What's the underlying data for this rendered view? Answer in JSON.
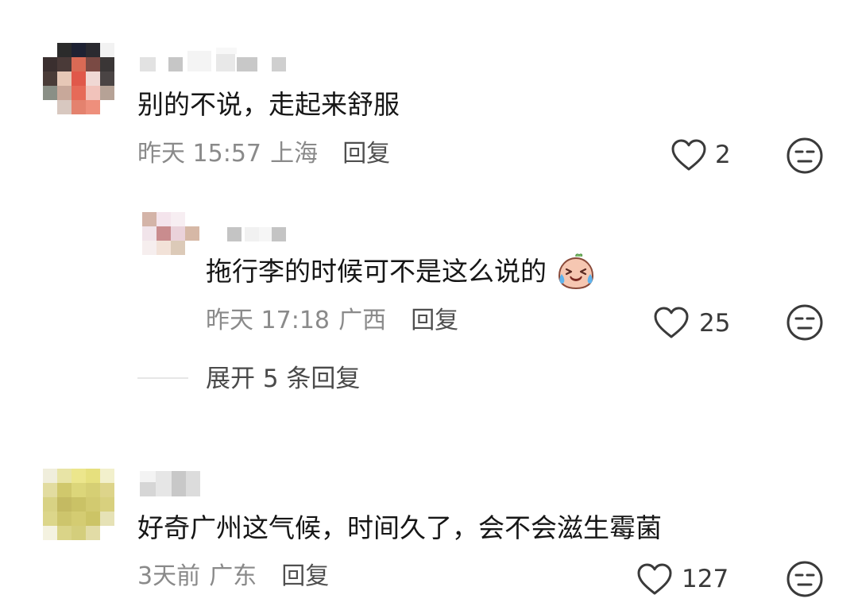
{
  "comments": [
    {
      "text": "别的不说，走起来舒服",
      "time": "昨天 15:57",
      "location": "上海",
      "reply_label": "回复",
      "likes": "2",
      "like_icon": "heart-outline-icon",
      "dislike_icon": "neutral-face-icon"
    },
    {
      "text": "拖行李的时候可不是这么说的",
      "emoji": "crying-face-emoji",
      "time": "昨天 17:18",
      "location": "广西",
      "reply_label": "回复",
      "likes": "25",
      "like_icon": "heart-outline-icon",
      "dislike_icon": "neutral-face-icon"
    },
    {
      "text": "好奇广州这气候，时间久了，会不会滋生霉菌",
      "time": "3天前",
      "location": "广东",
      "reply_label": "回复",
      "likes": "127",
      "like_icon": "heart-outline-icon",
      "dislike_icon": "neutral-face-icon"
    }
  ],
  "expand_replies": {
    "label": "展开 5 条回复"
  },
  "colors": {
    "text": "#161616",
    "meta": "#8a8a8a",
    "icon": "#3a3a3a"
  }
}
